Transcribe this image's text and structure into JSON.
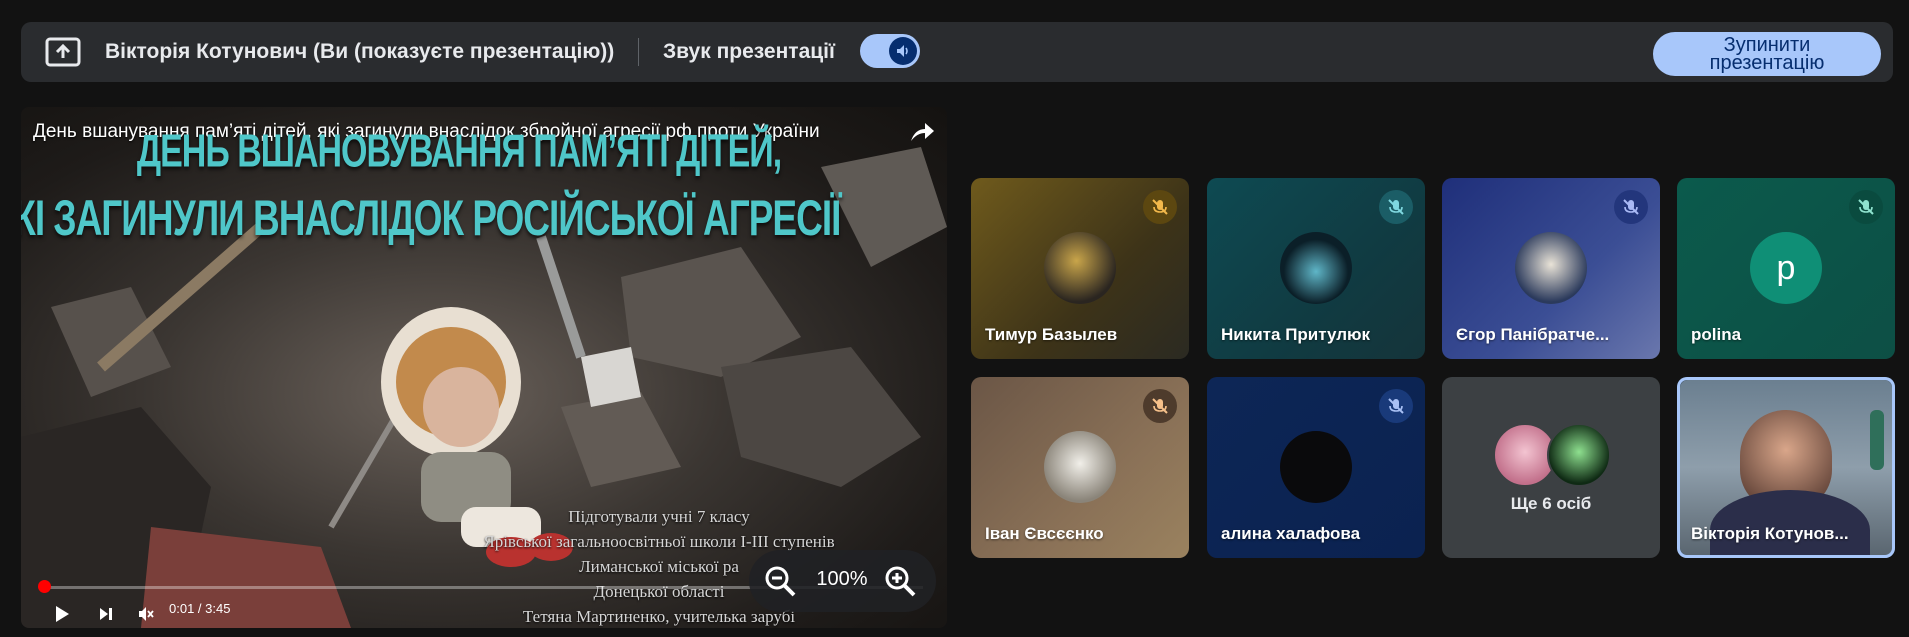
{
  "topbar": {
    "presenter": "Вікторія Котунович (Ви (показуєте презентацію))",
    "sound_label": "Звук презентації",
    "stop_button": "Зупинити презентацію",
    "icons": [
      "present-to-all-icon",
      "volume-icon"
    ],
    "accent": "#a8c7fa"
  },
  "presentation": {
    "video_title": "День вшанування пам’яті дітей, які загинули внаслідок збройної агресії рф проти України",
    "heading_line1": "ДЕНЬ ВШАНОВУВАННЯ ПАМ’ЯТІ ДІТЕЙ,",
    "heading_line2": "ЯКІ ЗАГИНУЛИ ВНАСЛІДОК РОСІЙСЬКОЇ АГРЕСІЇ",
    "credits": [
      "Підготували   учні 7 класу",
      "Ярівської загальноосвітньої школи І-ІІІ ступенів",
      "Лиманської міської ра",
      "Донецької областi",
      "Тетяна Мартиненко, учителька зарубі"
    ],
    "time": "0:01 / 3:45",
    "progress": 0.004,
    "zoom": "100%",
    "heading_color": "#4fc7c9"
  },
  "participants": [
    {
      "name": "Тимур Базылев",
      "muted": true
    },
    {
      "name": "Никита Притулюк",
      "muted": true
    },
    {
      "name": "Єгор Панібратче...",
      "muted": true
    },
    {
      "name": "polina",
      "muted": true,
      "initial": "p"
    },
    {
      "name": "Іван Євсєєнко",
      "muted": true
    },
    {
      "name": "алина халафова",
      "muted": true
    },
    {
      "name": "Ще 6 осіб"
    },
    {
      "name": "Вікторія Котунов..."
    }
  ]
}
